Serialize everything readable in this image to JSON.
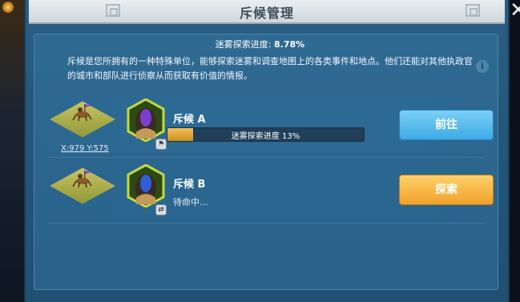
{
  "window": {
    "title": "斥候管理"
  },
  "fog": {
    "label": "迷雾探索进度:",
    "value": "8.78%"
  },
  "description": "斥候是您所拥有的一种特殊单位，能够探索迷雾和调查地图上的各类事件和地点。他们还能对其他执政官的城市和部队进行侦察从而获取有价值的情报。",
  "scouts": [
    {
      "name": "斥候 A",
      "coord": "X:979 Y:575",
      "progress_text": "迷雾探索进度 13%",
      "progress": 0.13,
      "action": "前往"
    },
    {
      "name": "斥候 B",
      "status": "待命中...",
      "action": "探索"
    }
  ],
  "colors": {
    "go_button": "#3ea9e6",
    "explore_button": "#f1a229",
    "panel": "#2a5e83"
  }
}
